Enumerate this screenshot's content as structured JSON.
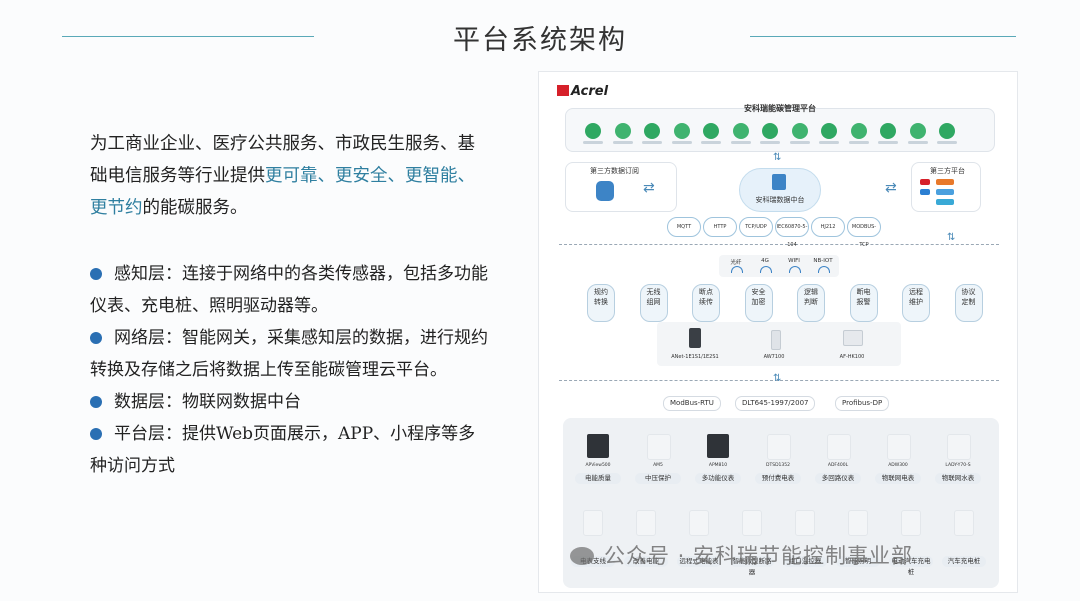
{
  "title": "平台系统架构",
  "intro": {
    "part1": "为工商业企业、医疗公共服务、市政民生服务、基础电信服务等行业提供",
    "highlight": "更可靠、更安全、更智能、更节约",
    "part2": "的能碳服务。"
  },
  "bullets": [
    {
      "text": "感知层：连接于网络中的各类传感器，包括多功能仪表、充电桩、照明驱动器等。"
    },
    {
      "text": "网络层：智能网关，采集感知层的数据，进行规约转换及存储之后将数据上传至能碳管理云平台。"
    },
    {
      "text": "数据层：物联网数据中台"
    },
    {
      "text": "平台层：提供Web页面展示，APP、小程序等多种访问方式"
    }
  ],
  "diagram": {
    "logo": "Acrel",
    "platform_title": "安科瑞能碳管理平台",
    "left_box_title": "第三方数据订阅",
    "right_box_title": "第三方平台",
    "data_center": "安科瑞数据中台",
    "clouds": [
      "MQTT",
      "HTTP",
      "TCP/UDP",
      "IEC60870-5-104",
      "HJ212",
      "MODBUS-TCP"
    ],
    "links": [
      "光纤",
      "4G",
      "WIFI",
      "NB-IOT"
    ],
    "functions": [
      "规约\n转换",
      "无线\n组网",
      "断点\n续传",
      "安全\n加密",
      "逻辑\n判断",
      "断电\n报警",
      "远程\n维护",
      "协议\n定制"
    ],
    "gateways": [
      "ANet-1E1S1/1E2S1",
      "AW7100",
      "AF-HK100"
    ],
    "protocols": [
      "ModBus-RTU",
      "DLT645-1997/2007",
      "Profibus-DP"
    ],
    "row1_models": [
      "APView500",
      "AM5",
      "APM810",
      "DTSD1352",
      "ADF400L",
      "ADW300",
      "LADY-Y70-S"
    ],
    "row1_labels": [
      "电能质量",
      "中压保护",
      "多功能仪表",
      "预付费电表",
      "多回路仪表",
      "物联网电表",
      "物联网水表"
    ],
    "row2_labels": [
      "电表支线",
      "改善电能",
      "远程式电能表",
      "智能微型断路器",
      "组口温控器",
      "智能照明",
      "电动汽车充电桩",
      "汽车充电桩"
    ]
  },
  "watermark": "公众号 · 安科瑞节能控制事业部",
  "colors": {
    "accent": "#2f7fa0",
    "bullet": "#2a6fb3",
    "rule": "#5aa9b8",
    "icon_green": "#38b06a"
  }
}
